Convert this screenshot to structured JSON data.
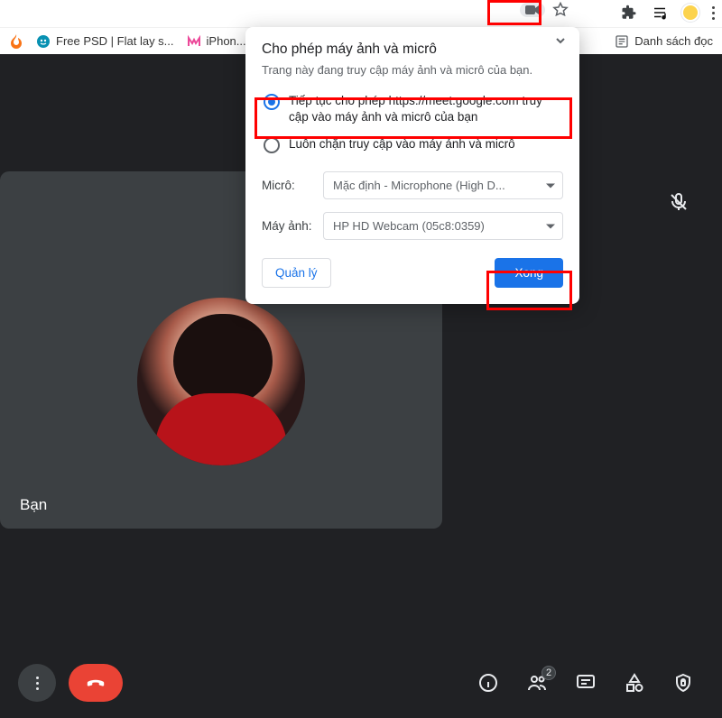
{
  "bookmarks": {
    "item1": "Free PSD | Flat lay s...",
    "item2": "iPhon...",
    "reading": "Danh sách đọc"
  },
  "permission": {
    "title": "Cho phép máy ảnh và micrô",
    "subtitle": "Trang này đang truy cập máy ảnh và micrô của bạn.",
    "option_allow": "Tiếp tục cho phép https://meet.google.com truy cập vào máy ảnh và micrô của bạn",
    "option_block": "Luôn chặn truy cập vào máy ảnh và micrô",
    "mic_label": "Micrô:",
    "mic_value": "Mặc định - Microphone (High D...",
    "cam_label": "Máy ảnh:",
    "cam_value": "HP HD Webcam (05c8:0359)",
    "manage": "Quản lý",
    "done": "Xong"
  },
  "meet": {
    "you_label": "Bạn",
    "people_count": "2"
  }
}
